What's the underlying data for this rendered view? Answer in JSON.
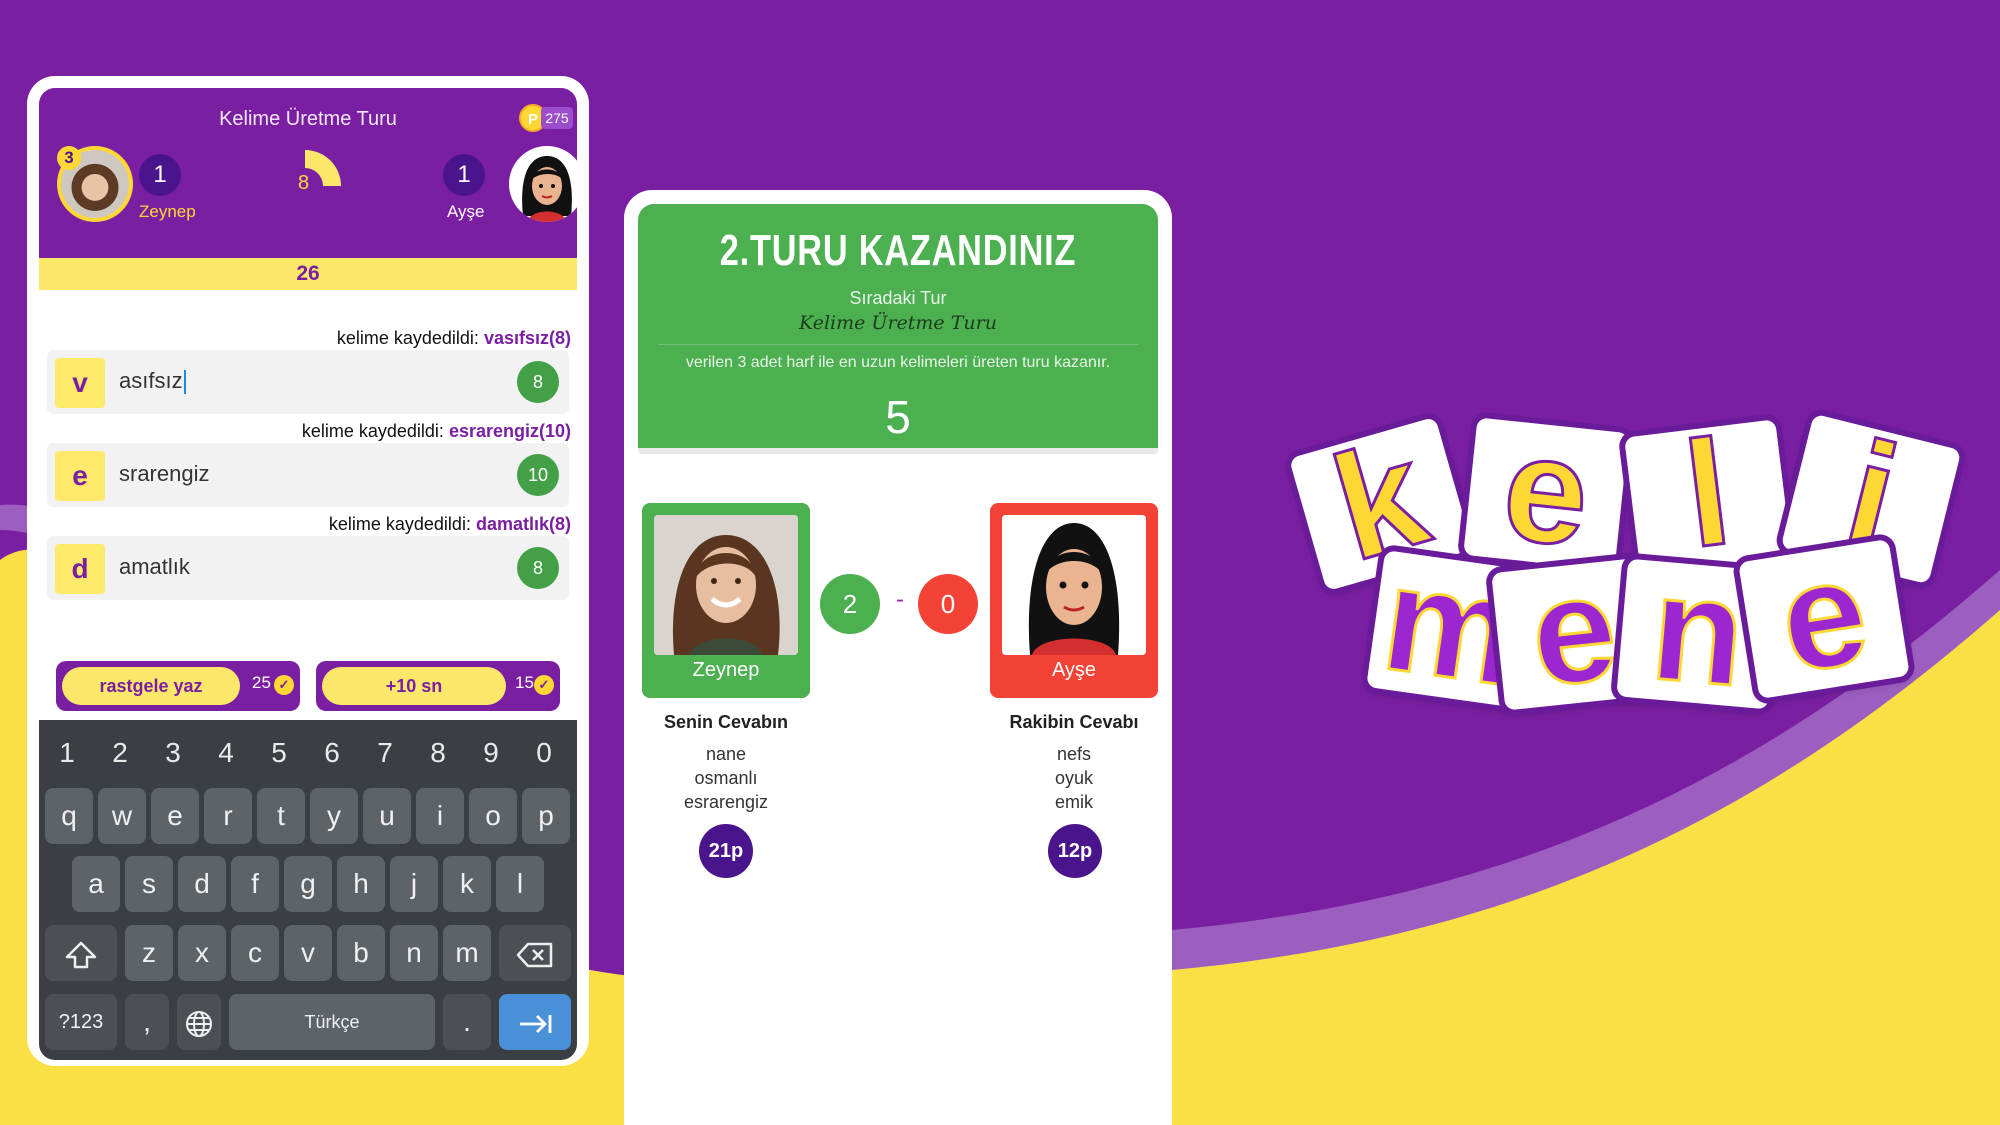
{
  "colors": {
    "purple": "#7b1fa2",
    "yellow": "#fdd835",
    "green": "#4caf50",
    "red": "#f44336",
    "dark_purple": "#4a148c"
  },
  "game_screen": {
    "title": "Kelime Üretme Turu",
    "coin_icon": "P",
    "coins": "275",
    "player": {
      "name": "Zeynep",
      "level": "3",
      "score": "1"
    },
    "opponent": {
      "name": "Ayşe",
      "score": "1"
    },
    "timer_value": "8",
    "round_timer": "26",
    "words": [
      {
        "saved_prefix": "kelime kaydedildi:",
        "saved_word": "vasıfsız(8)",
        "letter": "v",
        "text": "asıfsız",
        "points": "8"
      },
      {
        "saved_prefix": "kelime kaydedildi:",
        "saved_word": "esrarengiz(10)",
        "letter": "e",
        "text": "srarengiz",
        "points": "10"
      },
      {
        "saved_prefix": "kelime kaydedildi:",
        "saved_word": "damatlık(8)",
        "letter": "d",
        "text": "amatlık",
        "points": "8"
      }
    ],
    "powerups": [
      {
        "label": "rastgele yaz",
        "cost": "25"
      },
      {
        "label": "+10 sn",
        "cost": "15"
      }
    ],
    "keyboard": {
      "numbers": [
        "1",
        "2",
        "3",
        "4",
        "5",
        "6",
        "7",
        "8",
        "9",
        "0"
      ],
      "row1": [
        "q",
        "w",
        "e",
        "r",
        "t",
        "y",
        "u",
        "i",
        "o",
        "p"
      ],
      "row2": [
        "a",
        "s",
        "d",
        "f",
        "g",
        "h",
        "j",
        "k",
        "l"
      ],
      "row3": [
        "z",
        "x",
        "c",
        "v",
        "b",
        "n",
        "m"
      ],
      "mode_key": "?123",
      "comma_key": ",",
      "space_label": "Türkçe",
      "period_key": "."
    }
  },
  "result_screen": {
    "win_title": "2.TURU KAZANDINIZ",
    "next_label": "Sıradaki Tur",
    "next_round": "Kelime Üretme Turu",
    "rule_text": "verilen 3 adet harf ile en uzun kelimeleri üreten turu kazanır.",
    "countdown": "5",
    "player": {
      "name": "Zeynep",
      "score": "2",
      "answers_label": "Senin Cevabın",
      "answers": [
        "nane",
        "osmanlı",
        "esrarengiz"
      ],
      "points": "21p"
    },
    "opponent": {
      "name": "Ayşe",
      "score": "0",
      "answers_label": "Rakibin Cevabı",
      "answers": [
        "nefs",
        "oyuk",
        "emik"
      ],
      "points": "12p"
    },
    "separator": "-"
  },
  "logo": {
    "top_letters": [
      "k",
      "e",
      "l",
      "i"
    ],
    "bottom_letters": [
      "m",
      "e",
      "n",
      "e"
    ]
  }
}
